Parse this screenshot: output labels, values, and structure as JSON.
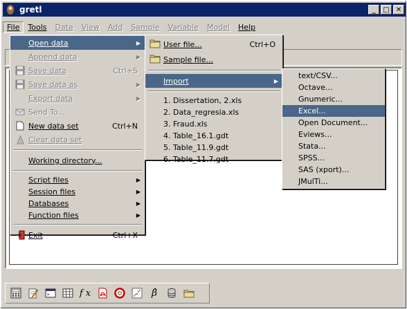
{
  "window": {
    "title": "gretl",
    "minimize": "_",
    "maximize": "□",
    "close": "✕"
  },
  "menubar": [
    "File",
    "Tools",
    "Data",
    "View",
    "Add",
    "Sample",
    "Variable",
    "Model",
    "Help"
  ],
  "file_menu": {
    "items": [
      {
        "label": "Open data",
        "icon": "",
        "accel": "",
        "submenu": true,
        "state": "highlight"
      },
      {
        "label": "Append data",
        "icon": "",
        "accel": "",
        "submenu": true,
        "state": "disabled"
      },
      {
        "label": "Save data",
        "icon": "save-icon",
        "accel": "Ctrl+S",
        "submenu": false,
        "state": "disabled"
      },
      {
        "label": "Save data as",
        "icon": "save-as-icon",
        "accel": "",
        "submenu": true,
        "state": "disabled"
      },
      {
        "label": "Export data",
        "icon": "",
        "accel": "",
        "submenu": true,
        "state": "disabled"
      },
      {
        "label": "Send To...",
        "icon": "mail-icon",
        "accel": "",
        "submenu": false,
        "state": "disabled"
      },
      {
        "label": "New data set",
        "icon": "new-file-icon",
        "accel": "Ctrl+N",
        "submenu": false,
        "state": "normal"
      },
      {
        "label": "Clear data set",
        "icon": "clear-icon",
        "accel": "",
        "submenu": false,
        "state": "disabled"
      },
      {
        "label": "Working directory...",
        "icon": "",
        "accel": "",
        "submenu": false,
        "state": "normal"
      },
      {
        "label": "Script files",
        "icon": "",
        "accel": "",
        "submenu": true,
        "state": "normal"
      },
      {
        "label": "Session files",
        "icon": "",
        "accel": "",
        "submenu": true,
        "state": "normal"
      },
      {
        "label": "Databases",
        "icon": "",
        "accel": "",
        "submenu": true,
        "state": "normal"
      },
      {
        "label": "Function files",
        "icon": "",
        "accel": "",
        "submenu": true,
        "state": "normal"
      },
      {
        "label": "Exit",
        "icon": "exit-icon",
        "accel": "Ctrl+X",
        "submenu": false,
        "state": "normal"
      }
    ]
  },
  "open_data_menu": {
    "user_file": "User file...",
    "user_file_accel": "Ctrl+O",
    "sample_file": "Sample file...",
    "import": "Import",
    "recent": [
      "1. Dissertation, 2.xls",
      "2. Data_regresia.xls",
      "3. Fraud.xls",
      "4. Table_16.1.gdt",
      "5. Table_11.9.gdt",
      "6. Table_11.7.gdt"
    ]
  },
  "import_menu": {
    "items": [
      "text/CSV...",
      "Octave...",
      "Gnumeric...",
      "Excel...",
      "Open Document...",
      "Eviews...",
      "Stata...",
      "SPSS...",
      "SAS (xport)...",
      "JMulTi..."
    ],
    "highlighted": "Excel..."
  },
  "toolbar": {
    "icons": [
      "calculator-icon",
      "edit-script-icon",
      "console-icon",
      "grid-icon",
      "function-icon",
      "pdf-help-icon",
      "lifebuoy-help-icon",
      "scatter-plot-icon",
      "beta-model-icon",
      "database-icon",
      "folder-icon"
    ],
    "fx_label": "f x",
    "beta_label": "β̂"
  },
  "colors": {
    "titlebar": "#0a246a",
    "highlight": "#4a6688",
    "face": "#d4d0c8"
  }
}
